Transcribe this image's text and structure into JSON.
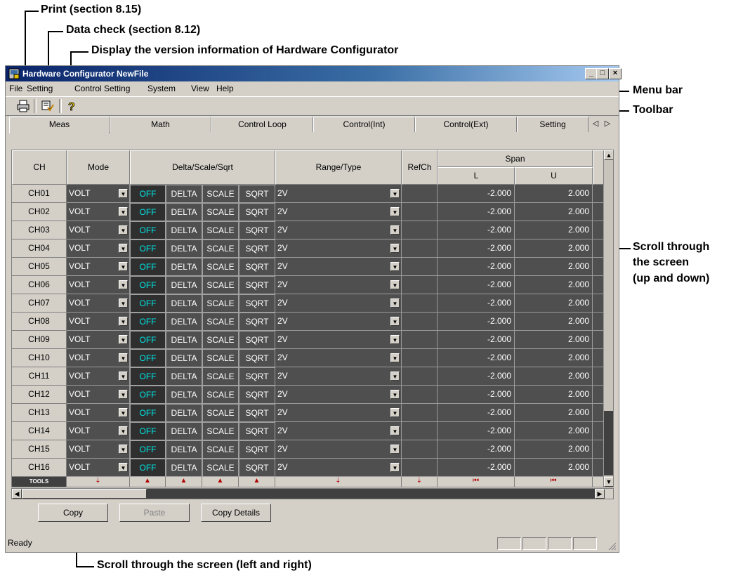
{
  "annotations": {
    "print": "Print (section 8.15)",
    "data_check": "Data check (section 8.12)",
    "version_info": "Display the version information of Hardware Configurator",
    "menu_bar": "Menu bar",
    "toolbar": "Toolbar",
    "scroll_vertical": [
      "Scroll through",
      "the screen",
      "(up and down)"
    ],
    "scroll_horizontal": "Scroll through the screen (left and right)"
  },
  "window": {
    "title": "Hardware Configurator NewFile",
    "controls": [
      "_",
      "□",
      "×"
    ]
  },
  "menu": [
    "File",
    "Setting",
    "Control Setting",
    "System",
    "View",
    "Help"
  ],
  "toolbar_icons": [
    "printer-icon",
    "data-check-icon",
    "help-icon"
  ],
  "tabs": [
    "Meas",
    "Math",
    "Control Loop",
    "Control(Int)",
    "Control(Ext)",
    "Setting"
  ],
  "active_tab": "Meas",
  "grid": {
    "headers": {
      "ch": "CH",
      "mode": "Mode",
      "dss": "Delta/Scale/Sqrt",
      "range": "Range/Type",
      "refch": "RefCh",
      "span": "Span",
      "span_l": "L",
      "span_u": "U"
    },
    "toggle_labels": [
      "OFF",
      "DELTA",
      "SCALE",
      "SQRT"
    ],
    "rows": [
      {
        "ch": "CH01",
        "mode": "VOLT",
        "range": "2V",
        "refch": "",
        "l": "-2.000",
        "u": "2.000"
      },
      {
        "ch": "CH02",
        "mode": "VOLT",
        "range": "2V",
        "refch": "",
        "l": "-2.000",
        "u": "2.000"
      },
      {
        "ch": "CH03",
        "mode": "VOLT",
        "range": "2V",
        "refch": "",
        "l": "-2.000",
        "u": "2.000"
      },
      {
        "ch": "CH04",
        "mode": "VOLT",
        "range": "2V",
        "refch": "",
        "l": "-2.000",
        "u": "2.000"
      },
      {
        "ch": "CH05",
        "mode": "VOLT",
        "range": "2V",
        "refch": "",
        "l": "-2.000",
        "u": "2.000"
      },
      {
        "ch": "CH06",
        "mode": "VOLT",
        "range": "2V",
        "refch": "",
        "l": "-2.000",
        "u": "2.000"
      },
      {
        "ch": "CH07",
        "mode": "VOLT",
        "range": "2V",
        "refch": "",
        "l": "-2.000",
        "u": "2.000"
      },
      {
        "ch": "CH08",
        "mode": "VOLT",
        "range": "2V",
        "refch": "",
        "l": "-2.000",
        "u": "2.000"
      },
      {
        "ch": "CH09",
        "mode": "VOLT",
        "range": "2V",
        "refch": "",
        "l": "-2.000",
        "u": "2.000"
      },
      {
        "ch": "CH10",
        "mode": "VOLT",
        "range": "2V",
        "refch": "",
        "l": "-2.000",
        "u": "2.000"
      },
      {
        "ch": "CH11",
        "mode": "VOLT",
        "range": "2V",
        "refch": "",
        "l": "-2.000",
        "u": "2.000"
      },
      {
        "ch": "CH12",
        "mode": "VOLT",
        "range": "2V",
        "refch": "",
        "l": "-2.000",
        "u": "2.000"
      },
      {
        "ch": "CH13",
        "mode": "VOLT",
        "range": "2V",
        "refch": "",
        "l": "-2.000",
        "u": "2.000"
      },
      {
        "ch": "CH14",
        "mode": "VOLT",
        "range": "2V",
        "refch": "",
        "l": "-2.000",
        "u": "2.000"
      },
      {
        "ch": "CH15",
        "mode": "VOLT",
        "range": "2V",
        "refch": "",
        "l": "-2.000",
        "u": "2.000"
      },
      {
        "ch": "CH16",
        "mode": "VOLT",
        "range": "2V",
        "refch": "",
        "l": "-2.000",
        "u": "2.000"
      }
    ],
    "tools_label": "TOOLS"
  },
  "buttons": {
    "copy": "Copy",
    "paste": "Paste",
    "copy_details": "Copy Details"
  },
  "status": "Ready",
  "colors": {
    "title_bar": "#0a246a",
    "grid_bg": "#4f4f4f",
    "off_text": "#00e5e5",
    "tools_arrow": "#b00000"
  }
}
